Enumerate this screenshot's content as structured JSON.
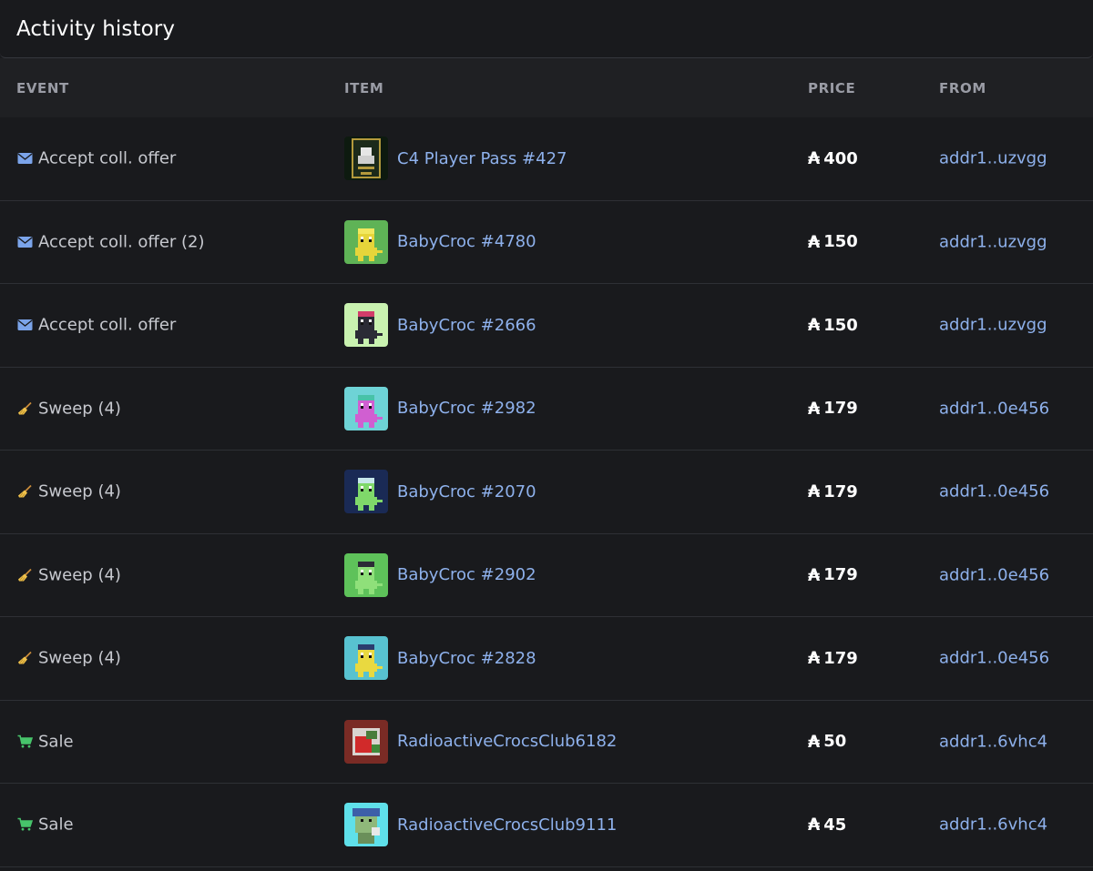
{
  "title": "Activity history",
  "columns": {
    "event": "EVENT",
    "item": "ITEM",
    "price": "PRICE",
    "from": "FROM"
  },
  "currency_symbol": "₳",
  "colors": {
    "link": "#8eb1ec",
    "envelope": "#7ba4ea",
    "sale": "#47c46b",
    "sweep": "#f0c24b"
  },
  "rows": [
    {
      "event": "Accept coll. offer",
      "event_icon": "envelope-icon",
      "item": "C4 Player Pass #427",
      "thumb": "pass",
      "price": "400",
      "from": "addr1..uzvgg"
    },
    {
      "event": "Accept coll. offer (2)",
      "event_icon": "envelope-icon",
      "item": "BabyCroc #4780",
      "thumb": "croc-green-yellow",
      "price": "150",
      "from": "addr1..uzvgg"
    },
    {
      "event": "Accept coll. offer",
      "event_icon": "envelope-icon",
      "item": "BabyCroc #2666",
      "thumb": "croc-lightgreen-dark",
      "price": "150",
      "from": "addr1..uzvgg"
    },
    {
      "event": "Sweep (4)",
      "event_icon": "broom-icon",
      "item": "BabyCroc #2982",
      "thumb": "croc-teal-pink",
      "price": "179",
      "from": "addr1..0e456"
    },
    {
      "event": "Sweep (4)",
      "event_icon": "broom-icon",
      "item": "BabyCroc #2070",
      "thumb": "croc-navy-green",
      "price": "179",
      "from": "addr1..0e456"
    },
    {
      "event": "Sweep (4)",
      "event_icon": "broom-icon",
      "item": "BabyCroc #2902",
      "thumb": "croc-green-green",
      "price": "179",
      "from": "addr1..0e456"
    },
    {
      "event": "Sweep (4)",
      "event_icon": "broom-icon",
      "item": "BabyCroc #2828",
      "thumb": "croc-teal-yellow",
      "price": "179",
      "from": "addr1..0e456"
    },
    {
      "event": "Sale",
      "event_icon": "cart-icon",
      "item": "RadioactiveCrocsClub6182",
      "thumb": "rcc-red",
      "price": "50",
      "from": "addr1..6vhc4"
    },
    {
      "event": "Sale",
      "event_icon": "cart-icon",
      "item": "RadioactiveCrocsClub9111",
      "thumb": "rcc-cyan",
      "price": "45",
      "from": "addr1..6vhc4"
    }
  ]
}
